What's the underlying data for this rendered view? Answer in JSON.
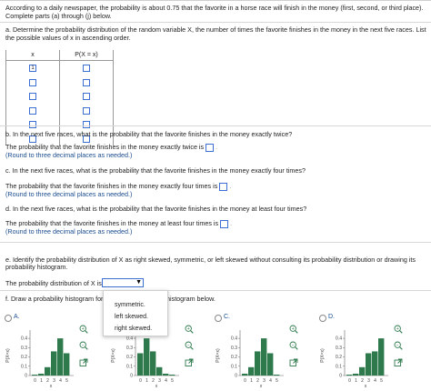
{
  "intro": {
    "line1": "According to a daily newspaper, the probability is about 0.75 that the favorite in a horse race will finish in the money (first, second, or third place).",
    "line2": "Complete parts (a) through (j) below."
  },
  "part_a": {
    "line1": "a.  Determine the probability distribution of the random variable X, the number of times the favorite finishes in the money in the next five races. List",
    "line2": "the possible values of x in ascending order.",
    "col_x": "x",
    "col_p": "P(X = x)",
    "first_value": "1"
  },
  "part_b": {
    "question": "b.  In the next five races, what is the probability that the favorite finishes in the money exactly twice?",
    "answer_prompt": "The probability that the favorite finishes in the money exactly twice is",
    "hint": "(Round to three decimal places as needed.)"
  },
  "part_c": {
    "question": "c.  In the next five races, what is the probability that the favorite finishes in the money exactly four times?",
    "answer_prompt": "The probability that the favorite finishes in the money exactly four times is",
    "hint": "(Round to three decimal places as needed.)"
  },
  "part_d": {
    "question": "d.  In the next five races, what is the probability that the favorite finishes in the money at least four times?",
    "answer_prompt": "The probability that the favorite finishes in the money at least four times is",
    "hint": "(Round to three decimal places as needed.)"
  },
  "part_e": {
    "line1": "e.  Identify the probability distribution of X as right skewed, symmetric, or left skewed without consulting its probability distribution or drawing its",
    "line2": "probability histogram.",
    "answer_prompt": "The probability distribution of X is",
    "options": [
      "symmetric.",
      "left skewed.",
      "right skewed."
    ]
  },
  "part_f": {
    "question_start": "f.  Draw a probability histogram for",
    "question_end": "histogram below."
  },
  "choices": [
    {
      "label": "A.",
      "heights": [
        0.01,
        0.02,
        0.09,
        0.26,
        0.4,
        0.24
      ]
    },
    {
      "label": "B.",
      "heights": [
        0.24,
        0.4,
        0.26,
        0.09,
        0.02,
        0.01
      ]
    },
    {
      "label": "C.",
      "heights": [
        0.02,
        0.09,
        0.26,
        0.4,
        0.24,
        0.01
      ]
    },
    {
      "label": "D.",
      "heights": [
        0.01,
        0.02,
        0.09,
        0.24,
        0.26,
        0.4
      ]
    }
  ],
  "chart_data": {
    "type": "bar",
    "ylabel": "P(X=x)",
    "xlabel": "x",
    "x_ticks": [
      "0",
      "1",
      "2",
      "3",
      "4",
      "5"
    ],
    "y_ticks": [
      "0",
      "0.1",
      "0.2",
      "0.3",
      "0.4"
    ],
    "ylim": [
      0,
      0.45
    ]
  },
  "colors": {
    "bar": "#2f7a4d",
    "accent": "#1a4d8f",
    "box_border": "#3b6fd1"
  },
  "icons": [
    "zoom-in-icon",
    "zoom-out-icon",
    "external-link-icon"
  ]
}
